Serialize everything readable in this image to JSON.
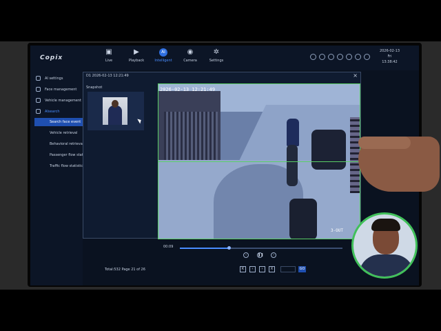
{
  "header": {
    "logo": "Copix",
    "nav": [
      {
        "label": "Live",
        "icon": "camera-icon"
      },
      {
        "label": "Playback",
        "icon": "play-icon"
      },
      {
        "label": "Intelligent",
        "icon": "ai-icon",
        "glyph": "AI",
        "active": true
      },
      {
        "label": "Camera",
        "icon": "webcam-icon"
      },
      {
        "label": "Settings",
        "icon": "gear-icon"
      }
    ],
    "date": "2026-02-13",
    "day": "Fri",
    "time": "13:38:42"
  },
  "sidebar": {
    "items": [
      {
        "label": "AI settings",
        "icon": "ai-settings-icon"
      },
      {
        "label": "Face management",
        "icon": "face-icon"
      },
      {
        "label": "Vehicle management",
        "icon": "vehicle-icon"
      },
      {
        "label": "AIsearch",
        "icon": "search-icon",
        "section": true
      }
    ],
    "sub_items": [
      {
        "label": "Search face event",
        "active": true
      },
      {
        "label": "Vehicle retrieval"
      },
      {
        "label": "Behavioral retrieval"
      },
      {
        "label": "Passenger flow statis"
      },
      {
        "label": "Traffic flow statistic"
      }
    ]
  },
  "dialog": {
    "header": "D1  2026-02-13 12:21:49",
    "close": "×",
    "snapshot_label": "Snapshot",
    "video_timestamp": "2026-02-13 12:21:49",
    "video_label": "3-OUT"
  },
  "playback": {
    "time": "00:09",
    "progress": 0.3,
    "controls": [
      "‹",
      "❚❚",
      "›"
    ]
  },
  "pagination": {
    "total": "Total:532  Page 21 of 26",
    "buttons": [
      "K",
      "‹",
      "›",
      "X"
    ],
    "go": "GO"
  },
  "colors": {
    "accent": "#2f6fe0",
    "highlight": "#1f4fb0",
    "detection": "#5ad066"
  }
}
